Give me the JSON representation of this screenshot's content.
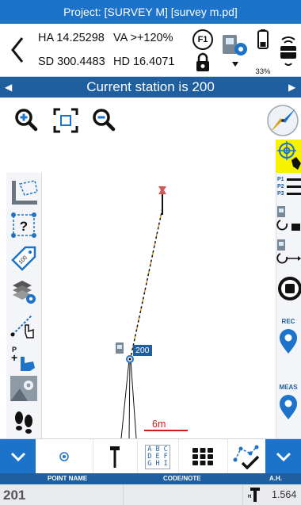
{
  "title_bar": {
    "project": "Project: [SURVEY M] [survey m.pd]"
  },
  "info": {
    "ha": "HA 14.25298",
    "va": "VA >+120%",
    "sd": "SD 300.4483",
    "hd": "HD 16.4071",
    "f1_label": "F1",
    "battery_percent": "33%"
  },
  "station_bar": {
    "text": "Current station is 200"
  },
  "map": {
    "station_label": "200",
    "scale_label": "6m"
  },
  "right_panel": {
    "point_list_labels": [
      "P1",
      "P2",
      "P3"
    ],
    "rec_label": "REC",
    "meas_label": "MEAS"
  },
  "toolbar": {
    "abc_rows": [
      "A B C",
      "D E F",
      "G H I"
    ]
  },
  "columns": {
    "point_name": "POINT NAME",
    "code_note": "CODE/NOTE",
    "ah": "A.H."
  },
  "row": {
    "point_name": "201",
    "code_note": "",
    "ah": "1.564"
  },
  "colors": {
    "title_blue": "#1c73c9",
    "station_blue": "#1f5fa0",
    "highlight_yellow": "#f6f200",
    "scale_red": "#d11a1a"
  }
}
